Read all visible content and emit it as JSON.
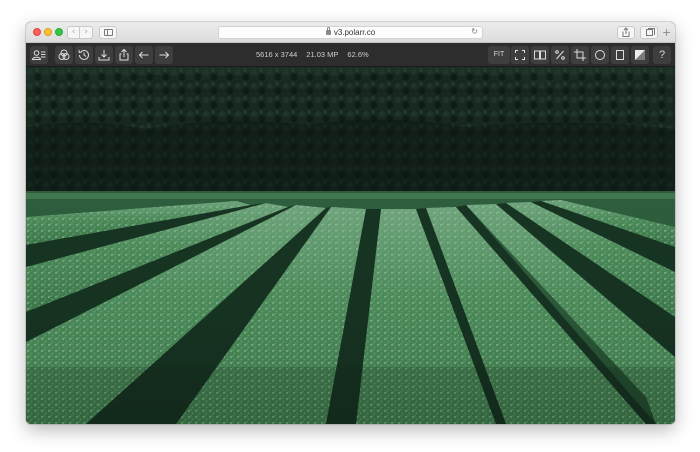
{
  "browser": {
    "url": "v3.polarr.co",
    "back_icon": "chevron-left-icon",
    "forward_icon": "chevron-right-icon",
    "reload_icon": "reload-icon"
  },
  "toolbar": {
    "left_icons": [
      "profile-icon",
      "filters-icon",
      "history-icon",
      "download-icon",
      "share-icon",
      "undo-icon",
      "redo-icon"
    ],
    "dimensions": "5616 x 3744",
    "megapixels": "21.03 MP",
    "zoom": "62.6%",
    "fit_label": "FIT",
    "right_icons": [
      "fullscreen-icon",
      "compare-icon",
      "percent-icon",
      "crop-icon",
      "circle-mask-icon",
      "square-icon",
      "histogram-icon",
      "help-icon"
    ],
    "help_label": "?"
  },
  "colors": {
    "toolbar_bg": "#2d2d2d",
    "button_bg": "#3e3e3e",
    "forest_dark": "#0f1e18",
    "tea_green": "#3f7a4c"
  }
}
